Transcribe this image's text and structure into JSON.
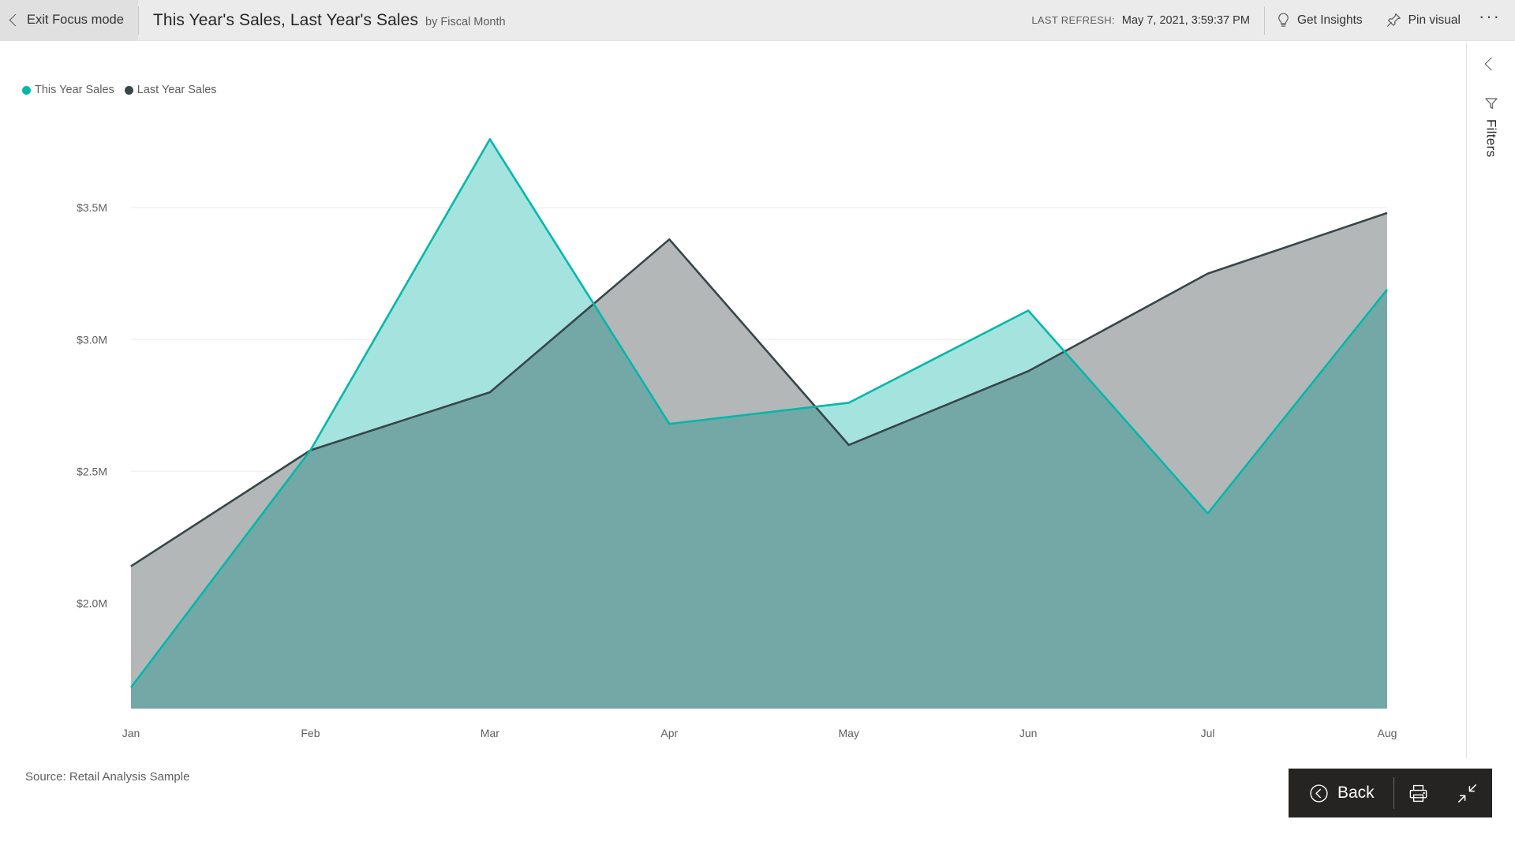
{
  "topbar": {
    "exit_focus_label": "Exit Focus mode",
    "visual_title": "This Year's Sales, Last Year's Sales",
    "visual_subtitle": "by Fiscal Month",
    "last_refresh_label": "LAST REFRESH:",
    "last_refresh_value": "May 7, 2021, 3:59:37 PM",
    "get_insights_label": "Get Insights",
    "pin_visual_label": "Pin visual",
    "more_options_label": "···"
  },
  "filters_panel": {
    "label": "Filters",
    "collapse_icon": "chevron-left-icon",
    "filter_icon": "funnel-icon"
  },
  "footer": {
    "source_text": "Source: Retail Analysis Sample",
    "back_label": "Back",
    "print_icon": "printer-icon",
    "exit_fullscreen_icon": "collapse-arrows-icon"
  },
  "colors": {
    "this_year": "#01B8AA",
    "this_year_fill": "#A5E3DE",
    "last_year": "#374649",
    "last_year_fill": "#B3B7B8",
    "overlap_fill": "#74A8A7",
    "gridline": "#F3F2F1",
    "axis_text": "#605E5C",
    "toolbar_bg": "#252423",
    "header_bg": "#EBEBEB"
  },
  "chart_data": {
    "type": "area",
    "title": "This Year's Sales, Last Year's Sales",
    "subtitle": "by Fiscal Month",
    "xlabel": "Fiscal Month",
    "ylabel": "",
    "grid": true,
    "legend_position": "top-left",
    "categories": [
      "Jan",
      "Feb",
      "Mar",
      "Apr",
      "May",
      "Jun",
      "Jul",
      "Aug"
    ],
    "ytick_labels": [
      "$3.5M",
      "$3.0M",
      "$2.5M",
      "$2.0M"
    ],
    "ytick_values": [
      3500000,
      3000000,
      2500000,
      2000000
    ],
    "ylim": [
      1600000,
      3800000
    ],
    "series": [
      {
        "name": "This Year Sales",
        "color": "#01B8AA",
        "values": [
          1680000,
          2580000,
          3760000,
          2680000,
          2760000,
          3110000,
          2340000,
          3190000
        ]
      },
      {
        "name": "Last Year Sales",
        "color": "#374649",
        "values": [
          2140000,
          2580000,
          2800000,
          3380000,
          2600000,
          2880000,
          3250000,
          3480000
        ]
      }
    ]
  }
}
